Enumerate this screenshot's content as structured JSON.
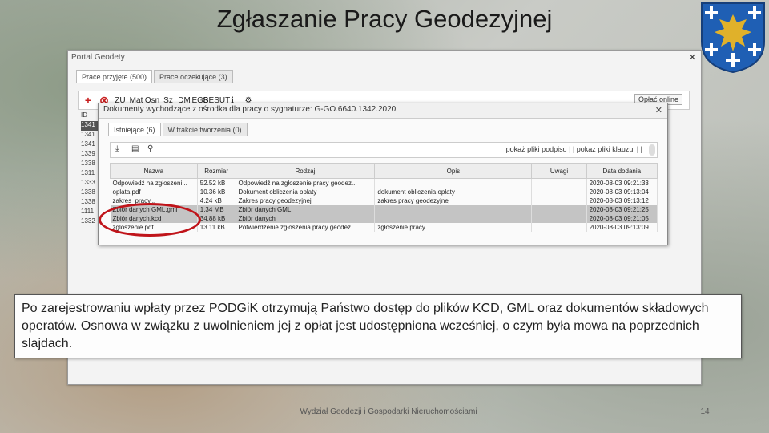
{
  "slide": {
    "title": "Zgłaszanie Pracy Geodezyjnej",
    "footer": "Wydział Geodezji i Gospodarki Nieruchomościami",
    "page_number": "14",
    "caption": "Po zarejestrowaniu wpłaty przez PODGiK otrzymują Państwo dostęp do plików KCD, GML oraz dokumentów składowych operatów. Osnowa w związku z uwolnieniem jej z opłat jest udostępniona wcześniej, o czym była mowa na poprzednich slajdach."
  },
  "portal": {
    "window_title": "Portal Geodety",
    "tabs": [
      "Prace przyjęte (500)",
      "Prace oczekujące (3)"
    ],
    "toolbar_icons": [
      "+",
      "⊗",
      "ZU",
      "Mat",
      "Osn",
      "Sz",
      "DM",
      "EGB",
      "GESUT",
      "ℹ",
      "⚙"
    ],
    "online_button": "Opłać online",
    "left_rows": [
      "ID",
      "1341",
      "1341",
      "1341",
      "1339",
      "1338",
      "1311",
      "1333",
      "1338",
      "1338",
      "1111",
      "1332"
    ]
  },
  "dialog": {
    "title": "Dokumenty wychodzące z ośrodka dla pracy o sygnaturze: G-GO.6640.1342.2020",
    "tabs": [
      "Istniejące (6)",
      "W trakcie tworzenia (0)"
    ],
    "links": "pokaż pliki podpisu | | pokaż pliki klauzul | |",
    "columns": [
      "Nazwa",
      "Rozmiar",
      "Rodzaj",
      "Opis",
      "Uwagi",
      "Data dodania"
    ],
    "rows": [
      {
        "name": "Odpowiedź na zgłoszeni...",
        "size": "52.52 kB",
        "type": "Odpowiedź na zgłoszenie pracy geodez...",
        "desc": "",
        "notes": "",
        "date": "2020-08-03 09:21:33"
      },
      {
        "name": "oplata.pdf",
        "size": "10.36 kB",
        "type": "Dokument obliczenia opłaty",
        "desc": "dokument obliczenia opłaty",
        "notes": "",
        "date": "2020-08-03 09:13:04"
      },
      {
        "name": "zakres_pracy...",
        "size": "4.24 kB",
        "type": "Zakres pracy geodezyjnej",
        "desc": "zakres pracy geodezyjnej",
        "notes": "",
        "date": "2020-08-03 09:13:12"
      },
      {
        "name": "Zbiór danych GML.gml",
        "size": "1.34 MB",
        "type": "Zbiór danych GML",
        "desc": "",
        "notes": "",
        "date": "2020-08-03 09:21:25"
      },
      {
        "name": "Zbiór danych.kcd",
        "size": "34.88 kB",
        "type": "Zbiór danych",
        "desc": "",
        "notes": "",
        "date": "2020-08-03 09:21:05"
      },
      {
        "name": "zgloszenie.pdf",
        "size": "13.11 kB",
        "type": "Potwierdzenie zgłoszenia pracy geodez...",
        "desc": "zgłoszenie pracy",
        "notes": "",
        "date": "2020-08-03 09:13:09"
      }
    ]
  },
  "colors": {
    "highlight_ellipse": "#c0141a",
    "coat_blue": "#1f5fb4",
    "coat_gold": "#e0b12a"
  }
}
